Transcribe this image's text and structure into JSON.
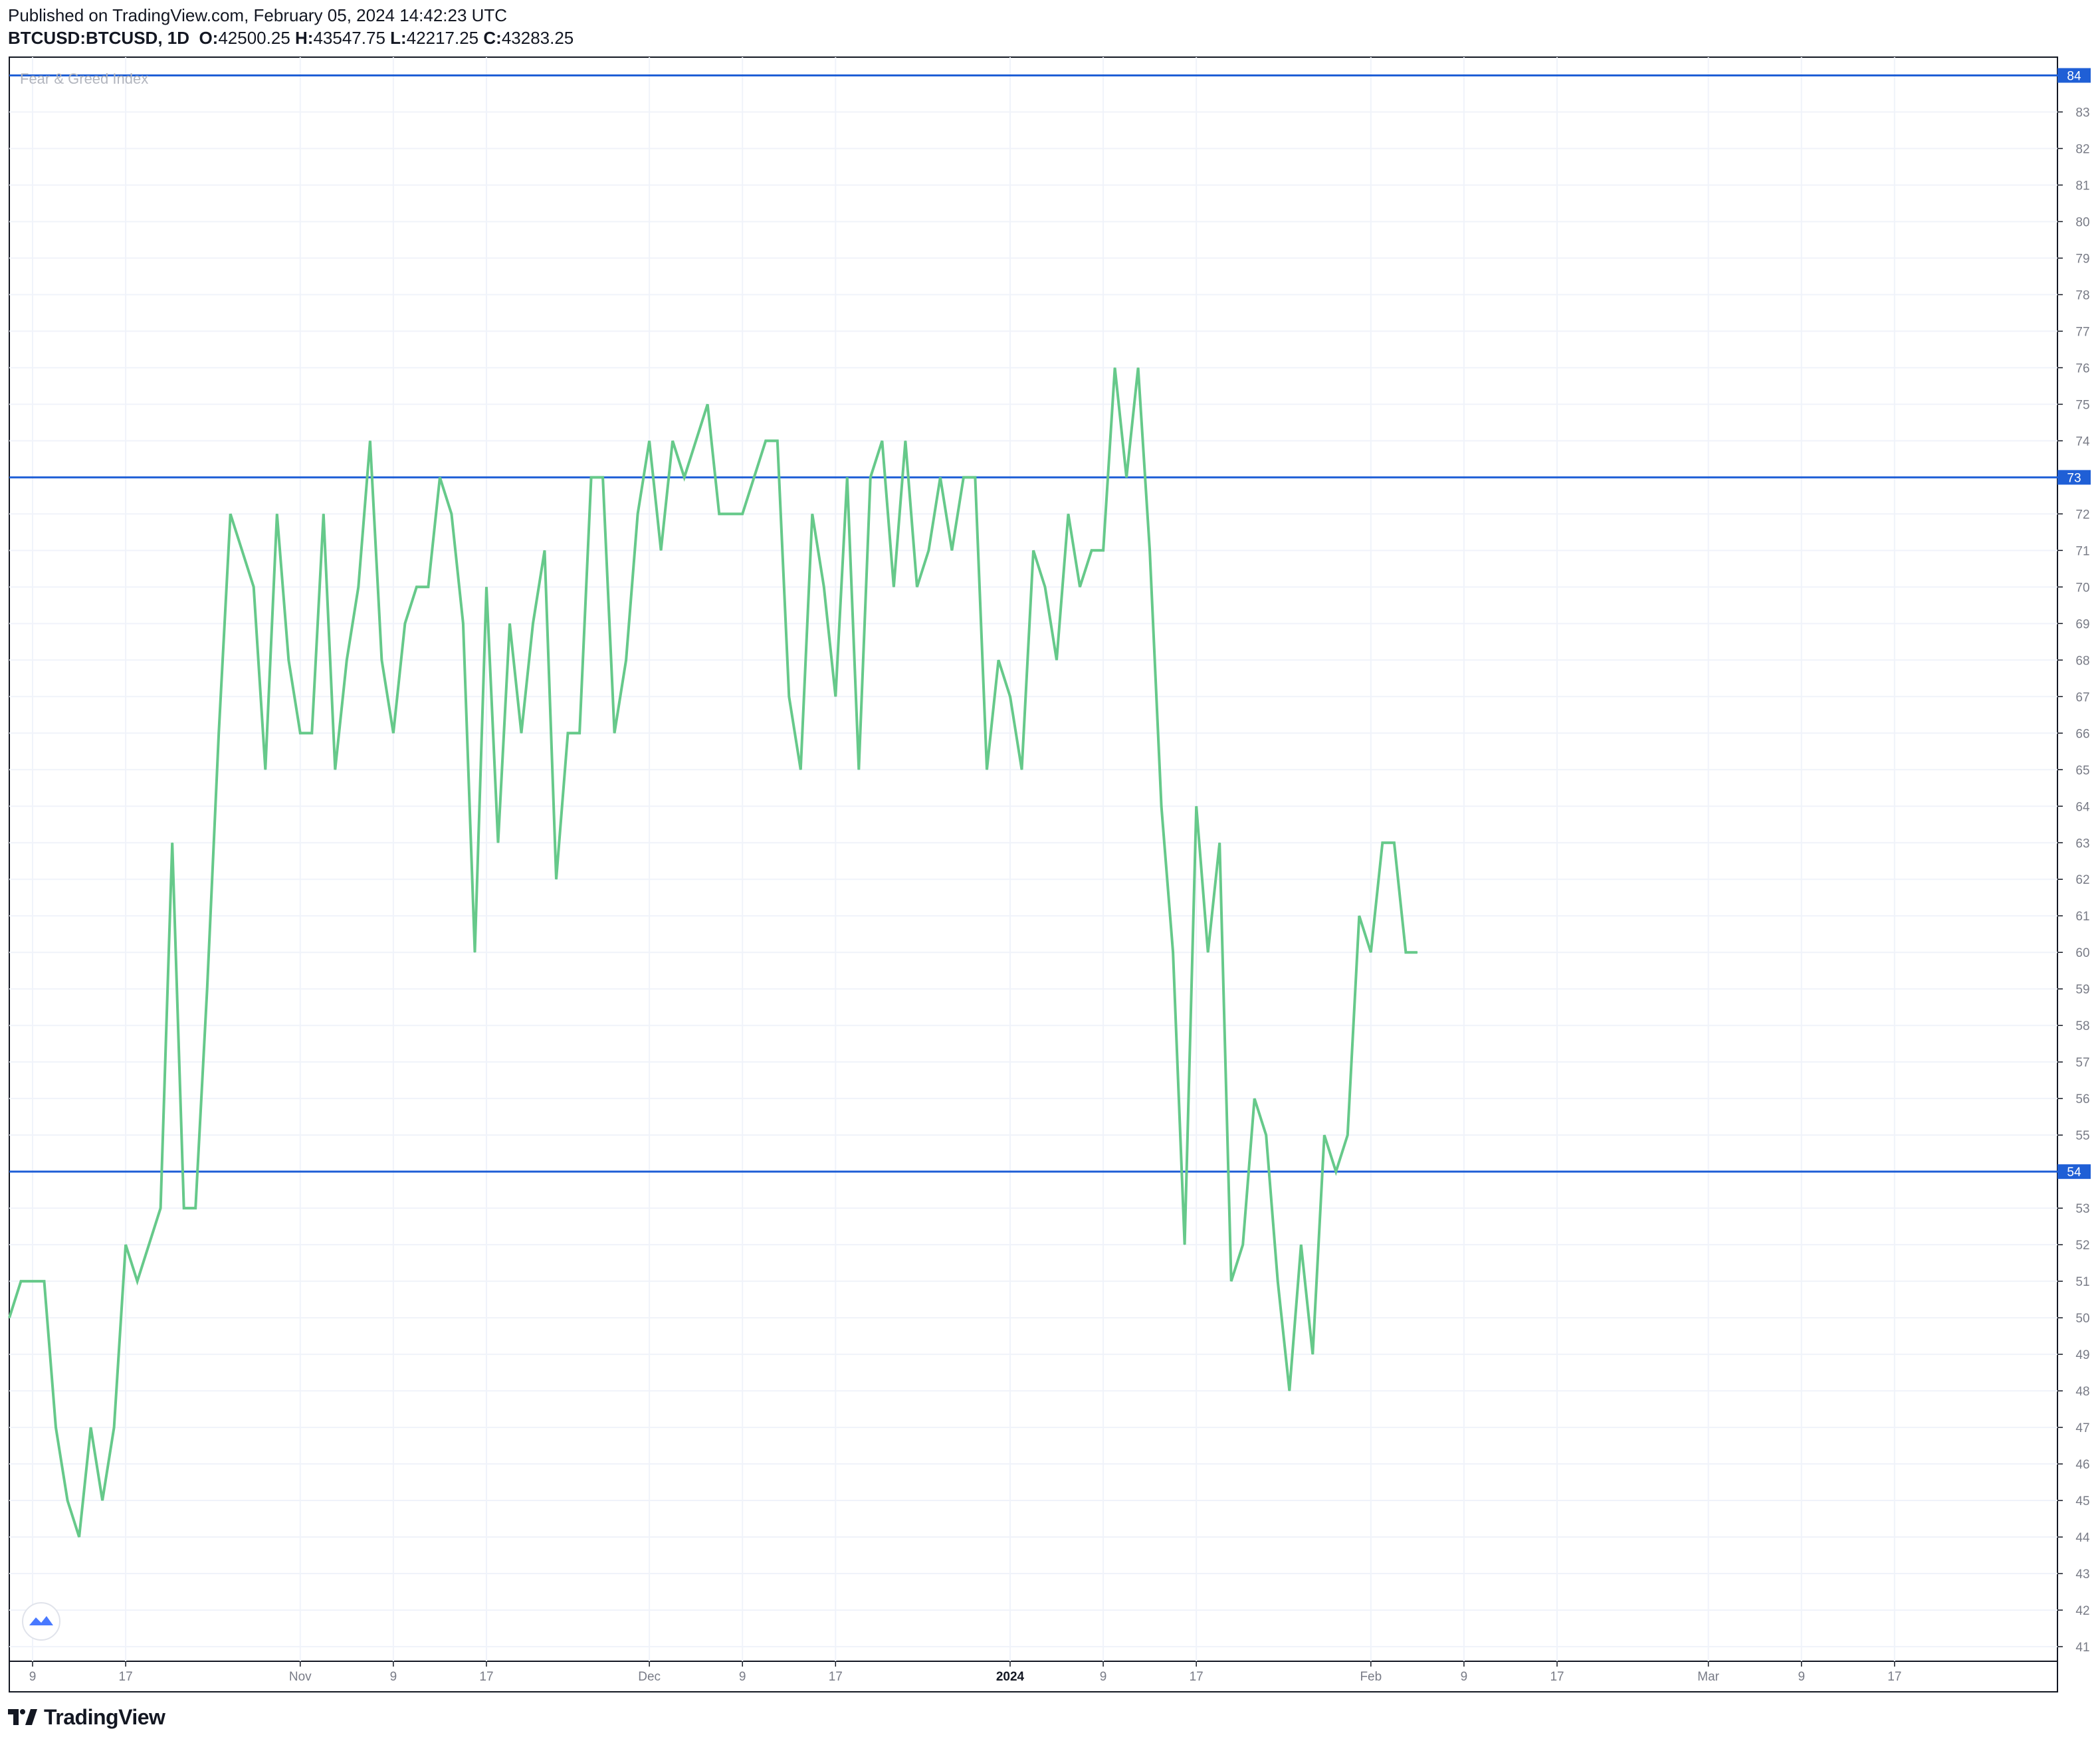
{
  "header": {
    "published": "Published on TradingView.com, February 05, 2024 14:42:23 UTC",
    "symbol": "BTCUSD:BTCUSD, 1D",
    "o_label": "O:",
    "o_value": "42500.25",
    "h_label": "H:",
    "h_value": "43547.75",
    "l_label": "L:",
    "l_value": "42217.25",
    "c_label": "C:",
    "c_value": "43283.25"
  },
  "indicator_label": "Fear & Greed Index",
  "footer": {
    "brand": "TradingView"
  },
  "colors": {
    "line": "#66c98a",
    "hline": "#1f5fd6",
    "grid": "#f0f3fa",
    "axis_text": "#787b86"
  },
  "chart_data": {
    "type": "line",
    "title": "Fear & Greed Index",
    "ylim": [
      40.6,
      84.5
    ],
    "y_ticks": [
      41,
      42,
      43,
      44,
      45,
      46,
      47,
      48,
      49,
      50,
      51,
      52,
      53,
      54,
      55,
      56,
      57,
      58,
      59,
      60,
      61,
      62,
      63,
      64,
      65,
      66,
      67,
      68,
      69,
      70,
      71,
      72,
      73,
      74,
      75,
      76,
      77,
      78,
      79,
      80,
      81,
      82,
      83,
      84
    ],
    "x_date_range": [
      "2023-10-07",
      "2024-03-31"
    ],
    "x_ticks": [
      {
        "date": "2023-10-09",
        "label": "9",
        "bold": false
      },
      {
        "date": "2023-10-17",
        "label": "17",
        "bold": false
      },
      {
        "date": "2023-11-01",
        "label": "Nov",
        "bold": false
      },
      {
        "date": "2023-11-09",
        "label": "9",
        "bold": false
      },
      {
        "date": "2023-11-17",
        "label": "17",
        "bold": false
      },
      {
        "date": "2023-12-01",
        "label": "Dec",
        "bold": false
      },
      {
        "date": "2023-12-09",
        "label": "9",
        "bold": false
      },
      {
        "date": "2023-12-17",
        "label": "17",
        "bold": false
      },
      {
        "date": "2024-01-01",
        "label": "2024",
        "bold": true
      },
      {
        "date": "2024-01-09",
        "label": "9",
        "bold": false
      },
      {
        "date": "2024-01-17",
        "label": "17",
        "bold": false
      },
      {
        "date": "2024-02-01",
        "label": "Feb",
        "bold": false
      },
      {
        "date": "2024-02-09",
        "label": "9",
        "bold": false
      },
      {
        "date": "2024-02-17",
        "label": "17",
        "bold": false
      },
      {
        "date": "2024-03-01",
        "label": "Mar",
        "bold": false
      },
      {
        "date": "2024-03-09",
        "label": "9",
        "bold": false
      },
      {
        "date": "2024-03-17",
        "label": "17",
        "bold": false
      }
    ],
    "horizontal_lines": [
      {
        "value": 84,
        "label": "84"
      },
      {
        "value": 73,
        "label": "73"
      },
      {
        "value": 54,
        "label": "54"
      }
    ],
    "series": [
      {
        "dates": [
          "2023-10-07",
          "2023-10-08",
          "2023-10-09",
          "2023-10-10",
          "2023-10-11",
          "2023-10-12",
          "2023-10-13",
          "2023-10-14",
          "2023-10-15",
          "2023-10-16",
          "2023-10-17",
          "2023-10-18",
          "2023-10-19",
          "2023-10-20",
          "2023-10-21",
          "2023-10-22",
          "2023-10-23",
          "2023-10-24",
          "2023-10-25",
          "2023-10-26",
          "2023-10-27",
          "2023-10-28",
          "2023-10-29",
          "2023-10-30",
          "2023-10-31",
          "2023-11-01",
          "2023-11-02",
          "2023-11-03",
          "2023-11-04",
          "2023-11-05",
          "2023-11-06",
          "2023-11-07",
          "2023-11-08",
          "2023-11-09",
          "2023-11-10",
          "2023-11-11",
          "2023-11-12",
          "2023-11-13",
          "2023-11-14",
          "2023-11-15",
          "2023-11-16",
          "2023-11-17",
          "2023-11-18",
          "2023-11-19",
          "2023-11-20",
          "2023-11-21",
          "2023-11-22",
          "2023-11-23",
          "2023-11-24",
          "2023-11-25",
          "2023-11-26",
          "2023-11-27",
          "2023-11-28",
          "2023-11-29",
          "2023-11-30",
          "2023-12-01",
          "2023-12-02",
          "2023-12-03",
          "2023-12-04",
          "2023-12-05",
          "2023-12-06",
          "2023-12-07",
          "2023-12-08",
          "2023-12-09",
          "2023-12-10",
          "2023-12-11",
          "2023-12-12",
          "2023-12-13",
          "2023-12-14",
          "2023-12-15",
          "2023-12-16",
          "2023-12-17",
          "2023-12-18",
          "2023-12-19",
          "2023-12-20",
          "2023-12-21",
          "2023-12-22",
          "2023-12-23",
          "2023-12-24",
          "2023-12-25",
          "2023-12-26",
          "2023-12-27",
          "2023-12-28",
          "2023-12-29",
          "2023-12-30",
          "2023-12-31",
          "2024-01-01",
          "2024-01-02",
          "2024-01-03",
          "2024-01-04",
          "2024-01-05",
          "2024-01-06",
          "2024-01-07",
          "2024-01-08",
          "2024-01-09",
          "2024-01-10",
          "2024-01-11",
          "2024-01-12",
          "2024-01-13",
          "2024-01-14",
          "2024-01-15",
          "2024-01-16",
          "2024-01-17",
          "2024-01-18",
          "2024-01-19",
          "2024-01-20",
          "2024-01-21",
          "2024-01-22",
          "2024-01-23",
          "2024-01-24",
          "2024-01-25",
          "2024-01-26",
          "2024-01-27",
          "2024-01-28",
          "2024-01-29",
          "2024-01-30",
          "2024-01-31",
          "2024-02-01",
          "2024-02-02",
          "2024-02-03",
          "2024-02-04",
          "2024-02-05"
        ],
        "values": [
          50,
          51,
          51,
          51,
          47,
          45,
          44,
          47,
          45,
          47,
          52,
          51,
          52,
          53,
          63,
          53,
          53,
          59,
          66,
          72,
          71,
          70,
          65,
          72,
          68,
          66,
          66,
          72,
          65,
          68,
          70,
          74,
          68,
          66,
          69,
          70,
          70,
          73,
          72,
          69,
          60,
          70,
          63,
          69,
          66,
          69,
          71,
          62,
          66,
          66,
          73,
          73,
          66,
          68,
          72,
          74,
          71,
          74,
          73,
          74,
          75,
          72,
          72,
          72,
          73,
          74,
          74,
          67,
          65,
          72,
          70,
          67,
          73,
          65,
          73,
          74,
          70,
          74,
          70,
          71,
          73,
          71,
          73,
          73,
          65,
          68,
          67,
          65,
          71,
          70,
          68,
          72,
          70,
          71,
          71,
          76,
          73,
          76,
          71,
          64,
          60,
          52,
          64,
          60,
          63,
          51,
          52,
          56,
          55,
          51,
          48,
          52,
          49,
          55,
          54,
          55,
          61,
          60,
          63,
          63,
          60,
          60
        ]
      }
    ]
  }
}
